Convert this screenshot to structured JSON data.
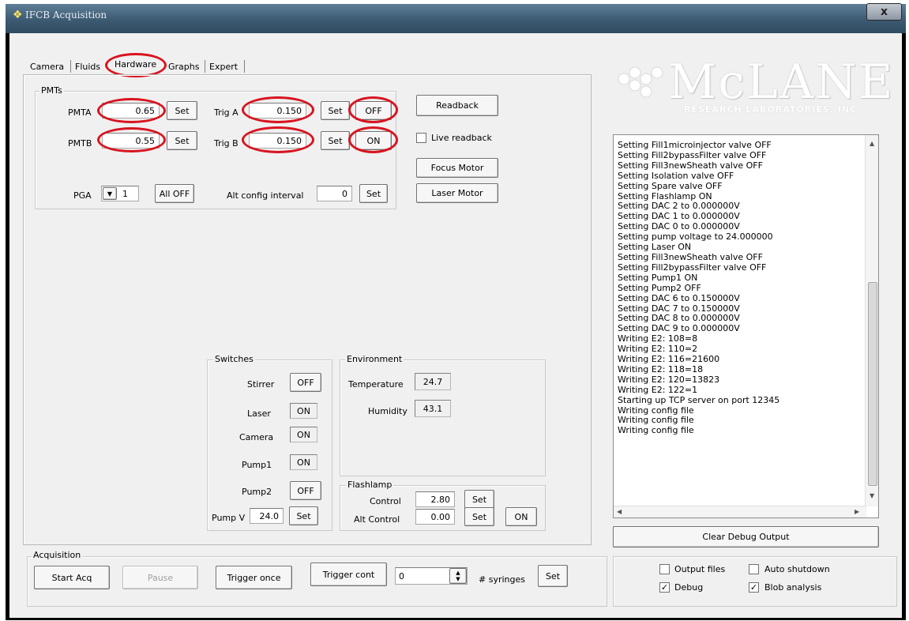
{
  "window": {
    "title": "IFCB Acquisition",
    "close_glyph": "x",
    "app_icon": "snowflake-icon"
  },
  "tabs": [
    {
      "label": "Camera"
    },
    {
      "label": "Fluids"
    },
    {
      "label": "Hardware"
    },
    {
      "label": "Graphs"
    },
    {
      "label": "Expert"
    }
  ],
  "active_tab": "Hardware",
  "logo": {
    "text": "McLANE",
    "subtext": "RESEARCH LABORATORIES, INC"
  },
  "pmts": {
    "group_label": "PMTs",
    "pmta_label": "PMTA",
    "pmta_value": "0.65",
    "pmtb_label": "PMTB",
    "pmtb_value": "0.55",
    "set_label": "Set",
    "triga_label": "Trig A",
    "triga_value": "0.150",
    "trigb_label": "Trig B",
    "trigb_value": "0.150",
    "triga_toggle": "OFF",
    "trigb_toggle": "ON",
    "pga_label": "PGA",
    "pga_value": "1",
    "all_off_label": "All OFF",
    "alt_config_label": "Alt config interval",
    "alt_config_value": "0"
  },
  "side_buttons": {
    "readback": "Readback",
    "live_readback": "Live readback",
    "focus_motor": "Focus Motor",
    "laser_motor": "Laser Motor"
  },
  "switches": {
    "group_label": "Switches",
    "items": [
      {
        "label": "Stirrer",
        "state": "OFF"
      },
      {
        "label": "Laser",
        "state": "ON"
      },
      {
        "label": "Camera",
        "state": "ON"
      },
      {
        "label": "Pump1",
        "state": "ON"
      },
      {
        "label": "Pump2",
        "state": "OFF"
      }
    ],
    "pump_v_label": "Pump V",
    "pump_v_value": "24.0",
    "set_label": "Set"
  },
  "environment": {
    "group_label": "Environment",
    "temperature_label": "Temperature",
    "temperature_value": "24.7",
    "humidity_label": "Humidity",
    "humidity_value": "43.1"
  },
  "flashlamp": {
    "group_label": "Flashlamp",
    "control_label": "Control",
    "control_value": "2.80",
    "alt_control_label": "Alt Control",
    "alt_control_value": "0.00",
    "set_label": "Set",
    "state": "ON"
  },
  "debug": {
    "lines": [
      "Setting Fill1microinjector valve OFF",
      "Setting Fill2bypassFilter valve OFF",
      "Setting Fill3newSheath valve OFF",
      "Setting Isolation valve OFF",
      "Setting Spare valve OFF",
      "Setting Flashlamp ON",
      "Setting DAC 2 to 0.000000V",
      "Setting DAC 1 to 0.000000V",
      "Setting DAC 0 to 0.000000V",
      "Setting pump voltage to 24.000000",
      "Setting Laser ON",
      "Setting Fill3newSheath valve OFF",
      "Setting Fill2bypassFilter valve OFF",
      "Setting Pump1 ON",
      "Setting Pump2 OFF",
      "Setting DAC 6 to 0.150000V",
      "Setting DAC 7 to 0.150000V",
      "Setting DAC 8 to 0.000000V",
      "Setting DAC 9 to 0.000000V",
      "Writing E2: 108=8",
      "Writing E2: 110=2",
      "Writing E2: 116=21600",
      "Writing E2: 118=18",
      "Writing E2: 120=13823",
      "Writing E2: 122=1",
      "Starting up TCP server on port 12345",
      "Writing config file",
      "Writing config file",
      "Writing config file"
    ],
    "clear_label": "Clear Debug Output"
  },
  "acquisition": {
    "group_label": "Acquisition",
    "start_label": "Start Acq",
    "pause_label": "Pause",
    "trigger_once_label": "Trigger once",
    "trigger_cont_label": "Trigger cont",
    "syringes_value": "0",
    "syringes_label": "# syringes",
    "set_label": "Set"
  },
  "options": {
    "output_files": {
      "label": "Output files",
      "checked": false
    },
    "auto_shutdown": {
      "label": "Auto shutdown",
      "checked": false
    },
    "debug": {
      "label": "Debug",
      "checked": true
    },
    "blob_analysis": {
      "label": "Blob analysis",
      "checked": true
    }
  },
  "colors": {
    "annotation_red": "#d8141f",
    "titlebar": "#4a6882"
  }
}
